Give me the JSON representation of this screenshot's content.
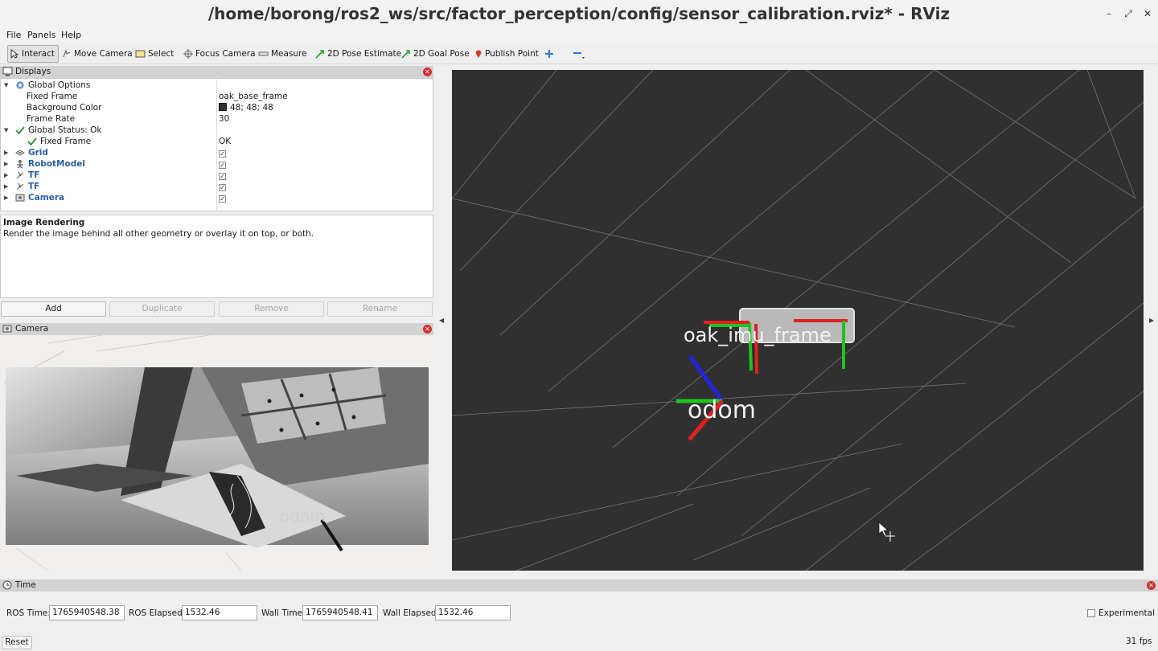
{
  "window": {
    "title": "/home/borong/ros2_ws/src/factor_perception/config/sensor_calibration.rviz* - RViz",
    "minimize": "–",
    "maximize": "⤢",
    "close": "✕"
  },
  "menu": {
    "file": "File",
    "panels": "Panels",
    "help": "Help"
  },
  "toolbar": {
    "interact": "Interact",
    "move_camera": "Move Camera",
    "select": "Select",
    "focus_camera": "Focus Camera",
    "measure": "Measure",
    "pose_estimate": "2D Pose Estimate",
    "goal_pose": "2D Goal Pose",
    "publish_point": "Publish Point"
  },
  "displays": {
    "title": "Displays",
    "global_options": "Global Options",
    "fixed_frame_label": "Fixed Frame",
    "fixed_frame_value": "oak_base_frame",
    "bg_color_label": "Background Color",
    "bg_color_value": "48; 48; 48",
    "bg_color_swatch": "#303030",
    "frame_rate_label": "Frame Rate",
    "frame_rate_value": "30",
    "global_status": "Global Status: Ok",
    "status_fixed_frame_label": "Fixed Frame",
    "status_fixed_frame_value": "OK",
    "items": [
      {
        "name": "Grid",
        "checked": true
      },
      {
        "name": "RobotModel",
        "checked": true
      },
      {
        "name": "TF",
        "checked": true
      },
      {
        "name": "TF",
        "checked": true
      },
      {
        "name": "Camera",
        "checked": true
      }
    ]
  },
  "description": {
    "title": "Image Rendering",
    "text": "Render the image behind all other geometry or overlay it on top, or both."
  },
  "buttons": {
    "add": "Add",
    "duplicate": "Duplicate",
    "remove": "Remove",
    "rename": "Rename"
  },
  "camera_panel": {
    "title": "Camera",
    "overlay_label": "odom"
  },
  "viewport": {
    "background": "#303030",
    "frame_imu": "oak_imu_frame",
    "frame_odom": "odom"
  },
  "time_panel": {
    "title": "Time",
    "ros_time_label": "ROS Time:",
    "ros_time": "1765940548.38",
    "ros_elapsed_label": "ROS Elapsed:",
    "ros_elapsed": "1532.46",
    "wall_time_label": "Wall Time:",
    "wall_time": "1765940548.41",
    "wall_elapsed_label": "Wall Elapsed:",
    "wall_elapsed": "1532.46",
    "experimental": "Experimental",
    "reset": "Reset",
    "fps": "31 fps"
  },
  "colors": {
    "axis_x": "#e02020",
    "axis_y": "#22c022",
    "axis_z": "#2222dd",
    "link_blue": "#2b5fa3"
  }
}
